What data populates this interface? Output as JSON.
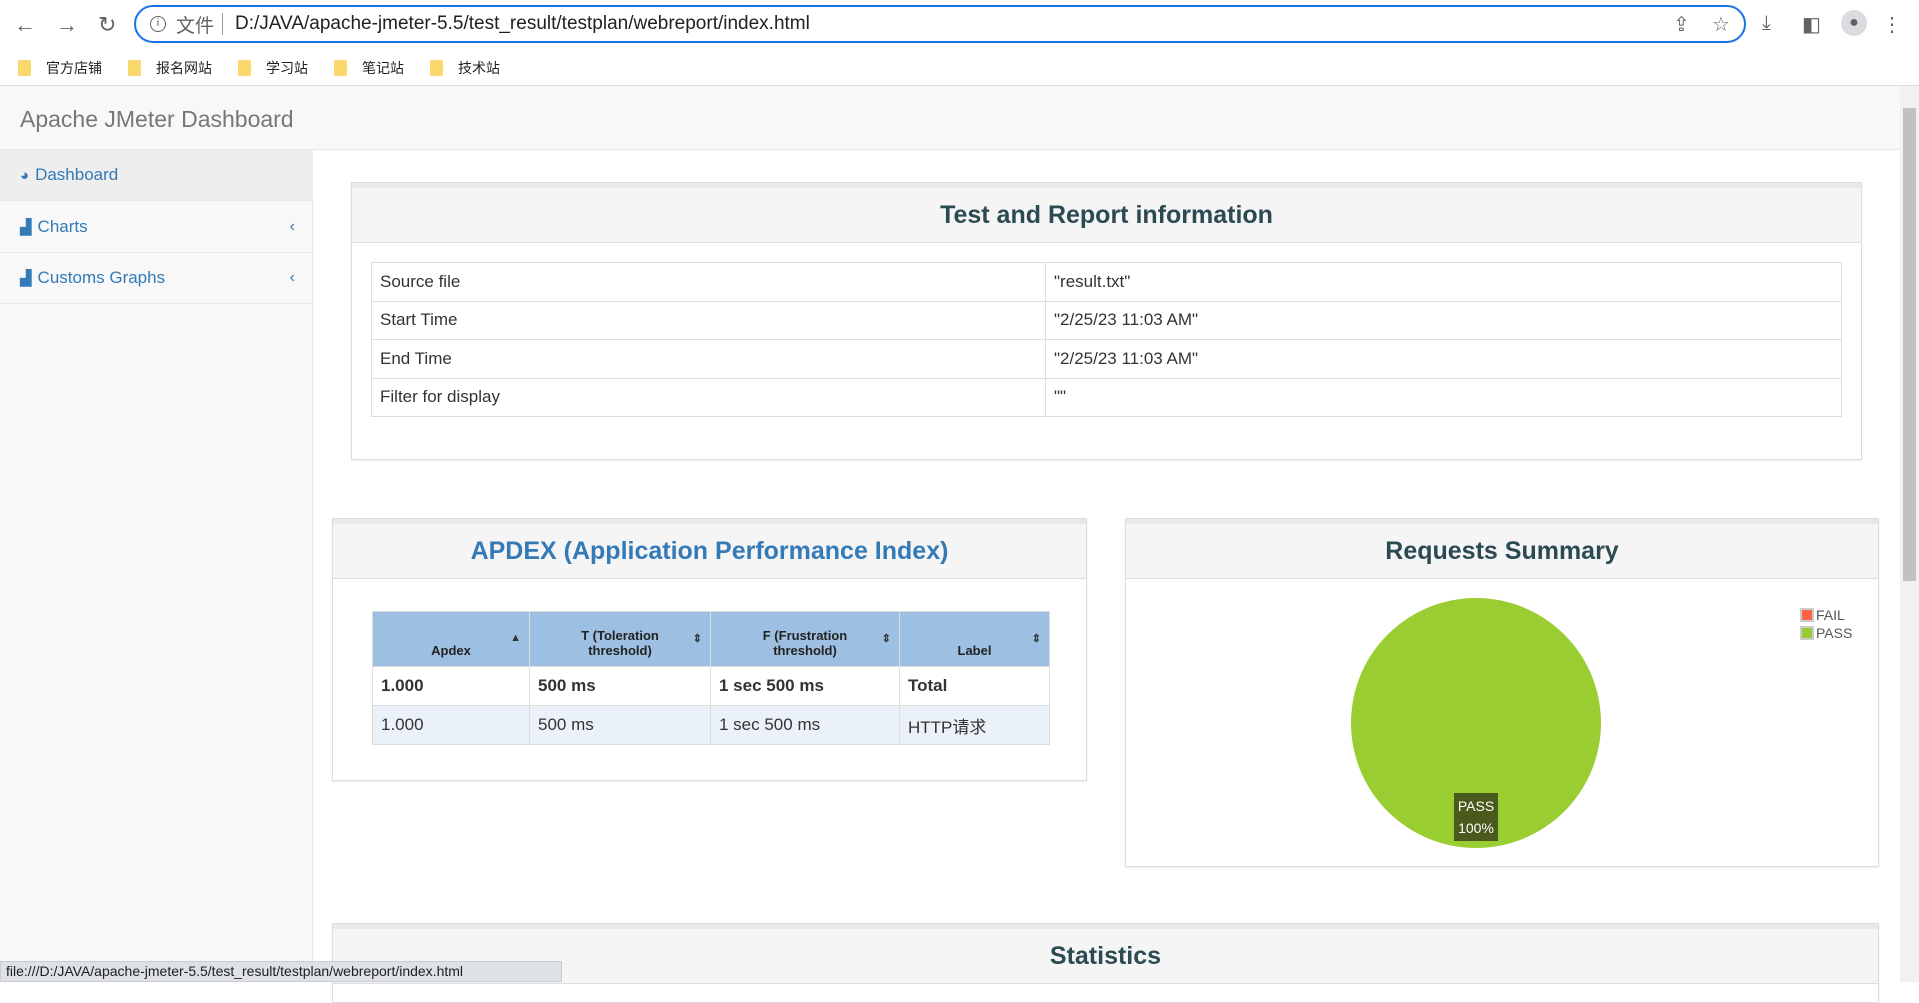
{
  "browser": {
    "url_prefix": "文件",
    "url": "D:/JAVA/apache-jmeter-5.5/test_result/testplan/webreport/index.html",
    "status_url": "file:///D:/JAVA/apache-jmeter-5.5/test_result/testplan/webreport/index.html",
    "bookmarks": [
      "官方店铺",
      "报名网站",
      "学习站",
      "笔记站",
      "技术站"
    ]
  },
  "app": {
    "title": "Apache JMeter Dashboard"
  },
  "sidebar": {
    "items": [
      {
        "label": "Dashboard",
        "icon": "dashboard-icon"
      },
      {
        "label": "Charts",
        "icon": "bar-chart-icon"
      },
      {
        "label": "Customs Graphs",
        "icon": "bar-chart-icon"
      }
    ]
  },
  "info": {
    "title": "Test and Report information",
    "rows": [
      [
        "Source file",
        "\"result.txt\""
      ],
      [
        "Start Time",
        "\"2/25/23 11:03 AM\""
      ],
      [
        "End Time",
        "\"2/25/23 11:03 AM\""
      ],
      [
        "Filter for display",
        "\"\""
      ]
    ]
  },
  "apdex": {
    "title": "APDEX (Application Performance Index)",
    "headers": [
      "Apdex",
      "T (Toleration threshold)",
      "F (Frustration threshold)",
      "Label"
    ],
    "rows": [
      [
        "1.000",
        "500 ms",
        "1 sec 500 ms",
        "Total"
      ],
      [
        "1.000",
        "500 ms",
        "1 sec 500 ms",
        "HTTP请求"
      ]
    ]
  },
  "summary": {
    "title": "Requests Summary"
  },
  "statistics": {
    "title": "Statistics"
  },
  "chart_data": {
    "type": "pie",
    "categories": [
      "FAIL",
      "PASS"
    ],
    "values": [
      0,
      100
    ],
    "colors": [
      "#ff6347",
      "#9acd32"
    ],
    "data_labels": [
      "PASS",
      "100%"
    ],
    "legend": "top-right"
  }
}
